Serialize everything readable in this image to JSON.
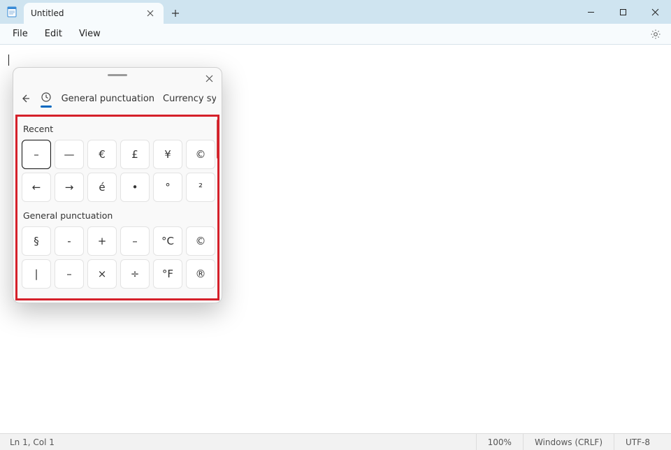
{
  "window": {
    "tab_title": "Untitled",
    "new_tab_tooltip": "New tab"
  },
  "menubar": {
    "file": "File",
    "edit": "Edit",
    "view": "View"
  },
  "statusbar": {
    "position": "Ln 1, Col 1",
    "zoom": "100%",
    "eol": "Windows (CRLF)",
    "encoding": "UTF-8"
  },
  "symbol_panel": {
    "nav": {
      "cat_general": "General punctuation",
      "cat_currency": "Currency symbols"
    },
    "recent_label": "Recent",
    "recent": [
      "–",
      "—",
      "€",
      "£",
      "¥",
      "©",
      "←",
      "→",
      "é",
      "•",
      "°",
      "²"
    ],
    "general_label": "General punctuation",
    "general_row1": [
      "§",
      "-",
      "+",
      "–",
      "°C",
      "©"
    ],
    "general_row2": [
      "|",
      "–",
      "×",
      "÷",
      "°F",
      "®"
    ]
  }
}
